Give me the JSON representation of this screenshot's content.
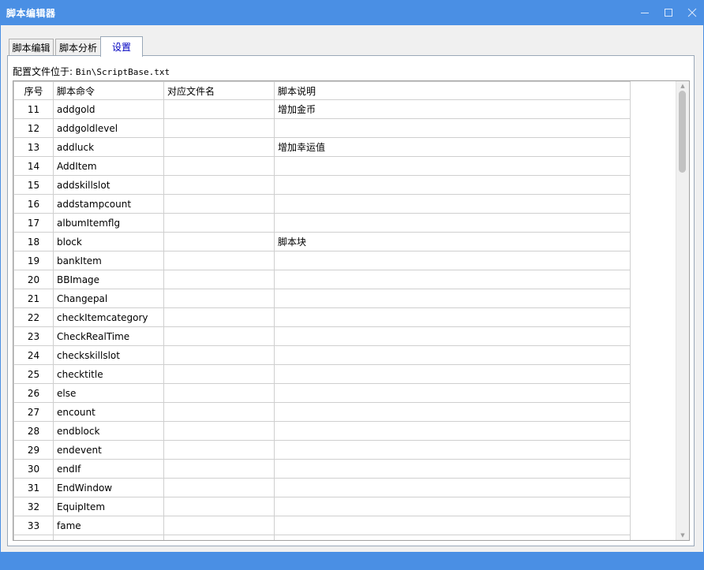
{
  "window": {
    "title": "脚本编辑器"
  },
  "tabs": [
    {
      "label": "脚本编辑"
    },
    {
      "label": "脚本分析"
    },
    {
      "label": "设置"
    }
  ],
  "settings": {
    "config_label": "配置文件位于:",
    "config_path": "Bin\\ScriptBase.txt"
  },
  "table": {
    "headers": [
      "序号",
      "脚本命令",
      "对应文件名",
      "脚本说明"
    ],
    "rows": [
      [
        "11",
        "addgold",
        "",
        "增加金币"
      ],
      [
        "12",
        "addgoldlevel",
        "",
        ""
      ],
      [
        "13",
        "addluck",
        "",
        "增加幸运值"
      ],
      [
        "14",
        "AddItem",
        "",
        ""
      ],
      [
        "15",
        "addskillslot",
        "",
        ""
      ],
      [
        "16",
        "addstampcount",
        "",
        ""
      ],
      [
        "17",
        "albumItemflg",
        "",
        ""
      ],
      [
        "18",
        "block",
        "",
        "脚本块"
      ],
      [
        "19",
        "bankItem",
        "",
        ""
      ],
      [
        "20",
        "BBImage",
        "",
        ""
      ],
      [
        "21",
        "Changepal",
        "",
        ""
      ],
      [
        "22",
        "checkItemcategory",
        "",
        ""
      ],
      [
        "23",
        "CheckRealTime",
        "",
        ""
      ],
      [
        "24",
        "checkskillslot",
        "",
        ""
      ],
      [
        "25",
        "checktitle",
        "",
        ""
      ],
      [
        "26",
        "else",
        "",
        ""
      ],
      [
        "27",
        "encount",
        "",
        ""
      ],
      [
        "28",
        "endblock",
        "",
        ""
      ],
      [
        "29",
        "endevent",
        "",
        ""
      ],
      [
        "30",
        "endIf",
        "",
        ""
      ],
      [
        "31",
        "EndWindow",
        "",
        ""
      ],
      [
        "32",
        "EquipItem",
        "",
        ""
      ],
      [
        "33",
        "fame",
        "",
        ""
      ],
      [
        "",
        "",
        "",
        ""
      ]
    ]
  },
  "icons": {
    "minimize": "minimize-icon",
    "maximize": "maximize-icon",
    "close": "close-icon",
    "scroll_up": "scroll-up-arrow-icon",
    "scroll_down": "scroll-down-arrow-icon"
  },
  "colors": {
    "titlebar": "#4a8fe4",
    "active_tab_text": "#0000c0"
  }
}
